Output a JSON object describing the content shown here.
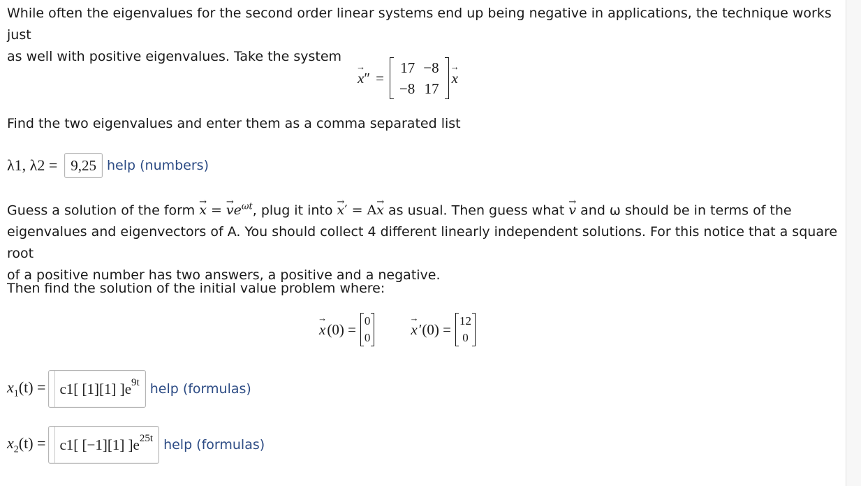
{
  "intro": {
    "line1": "While often the eigenvalues for the second order linear systems end up being negative in applications, the technique works just",
    "line2": "as well with positive eigenvalues. Take the system"
  },
  "system": {
    "lhs": "x",
    "prime": "″",
    "equals": "=",
    "matrix": [
      [
        "17",
        "−8"
      ],
      [
        "−8",
        "17"
      ]
    ],
    "rhs": "x"
  },
  "question1": "Find the two eigenvalues and enter them as a comma separated list",
  "eigen_answer": {
    "label": "λ1, λ2 =",
    "value": "9,25",
    "help": "help (numbers)"
  },
  "guess_paragraph": {
    "line1_a": "Guess a solution of the form",
    "line1_b": "= ",
    "line1_c": ", plug it into",
    "line1_d": "′ = A",
    "line1_e": " as usual. Then guess what",
    "line1_f": " and ω should be in terms of the",
    "line2": "eigenvalues and eigenvectors of A. You should collect 4 different linearly independent solutions. For this notice that a square root",
    "line3": "of a positive number has two answers, a positive and a negative."
  },
  "question2": "Then find the solution of the initial value problem where:",
  "initial_conditions": {
    "x0_label": "(0) =",
    "x0": [
      "0",
      "0"
    ],
    "xp0_label": "′(0) =",
    "xp0": [
      "12",
      "0"
    ]
  },
  "x1_answer": {
    "label_sub": "1",
    "label_rest": "(t) =",
    "value": "c1[ [1][1] ]e",
    "exponent": "9t",
    "help": "help (formulas)"
  },
  "x2_answer": {
    "label_sub": "2",
    "label_rest": "(t) =",
    "value": "c1[ [−1][1] ]e",
    "exponent": "25t",
    "help": "help (formulas)"
  }
}
